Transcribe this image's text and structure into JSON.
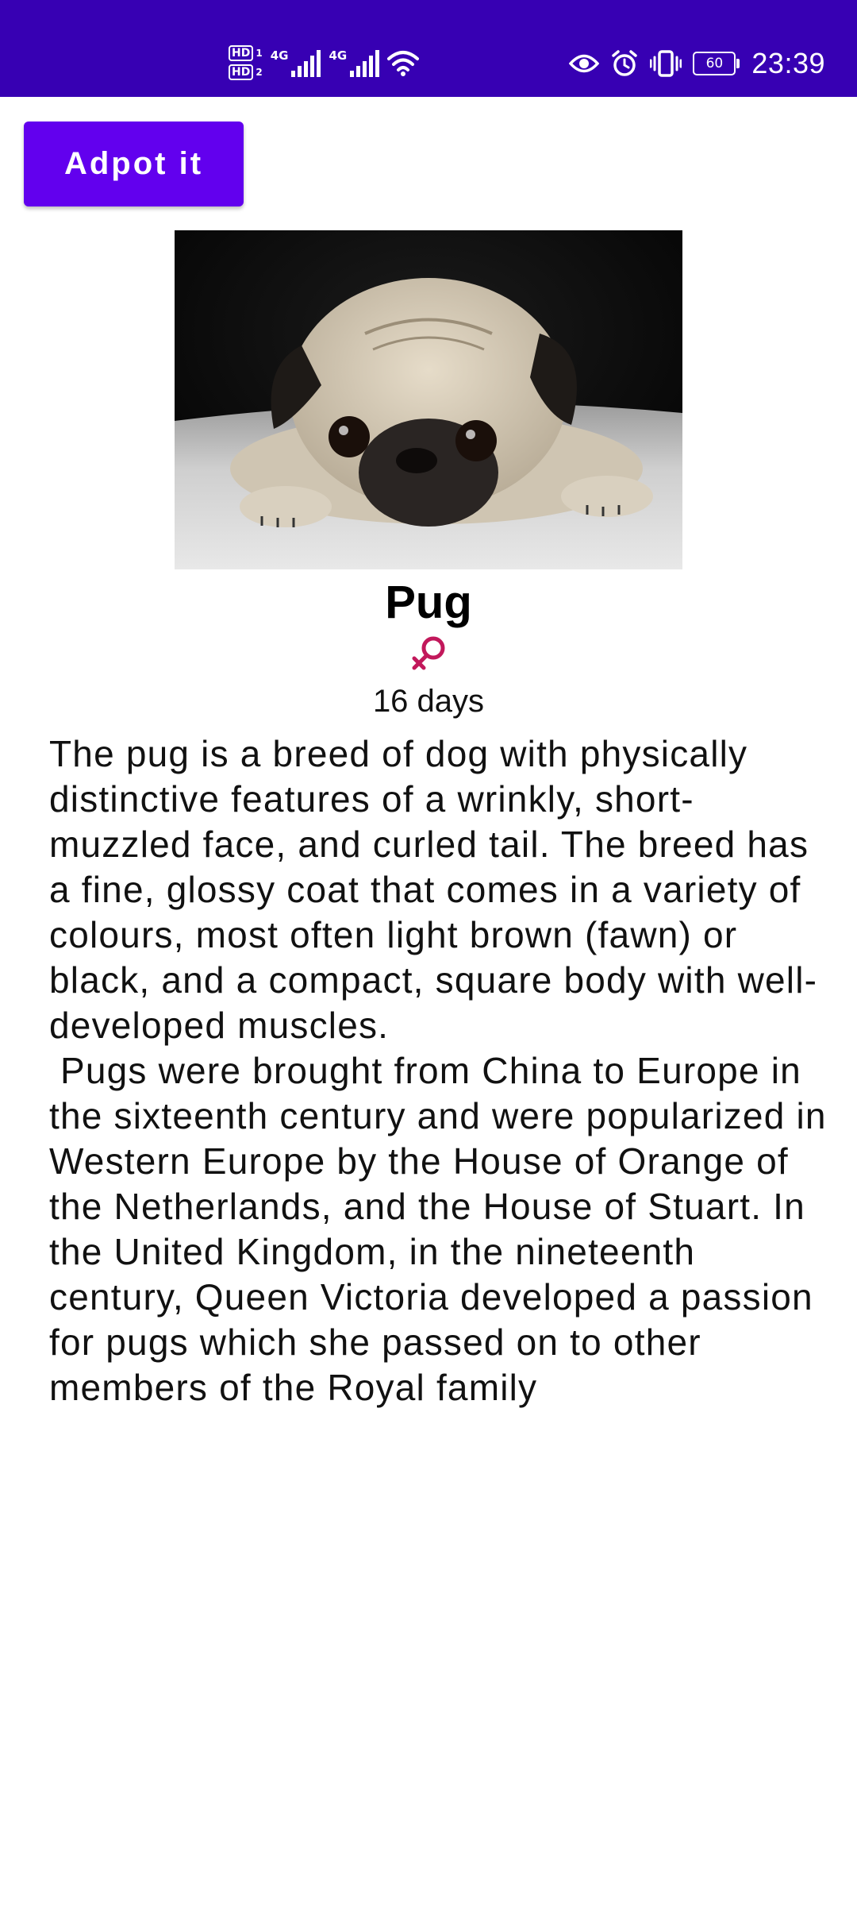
{
  "status_bar": {
    "hd_top": "HD",
    "hd_top_index": "1",
    "hd_bottom": "HD",
    "hd_bottom_index": "2",
    "network_1": "4G",
    "network_2": "4G",
    "battery_level": "60",
    "time": "23:39",
    "background_color": "#3700b3",
    "icons": [
      "signal-icon",
      "wifi-icon",
      "eye-icon",
      "alarm-icon",
      "vibrate-icon",
      "battery-icon"
    ]
  },
  "adopt_button": {
    "label": "Adpot it",
    "color": "#6200ee"
  },
  "pet": {
    "name": "Pug",
    "gender_icon": "female-icon",
    "gender_color": "#c2185b",
    "age": "16 days",
    "description": "The pug is a breed of dog with physically distinctive features of a wrinkly, short-muzzled face, and curled tail. The breed has a fine, glossy coat that comes in a variety of colours, most often light brown (fawn) or black, and a compact, square body with well-developed muscles.\n Pugs were brought from China to Europe in the sixteenth century and were popularized in Western Europe by the House of Orange of the Netherlands, and the House of Stuart. In the United Kingdom, in the nineteenth century, Queen Victoria developed a passion for pugs which she passed on to other members of the Royal family"
  }
}
